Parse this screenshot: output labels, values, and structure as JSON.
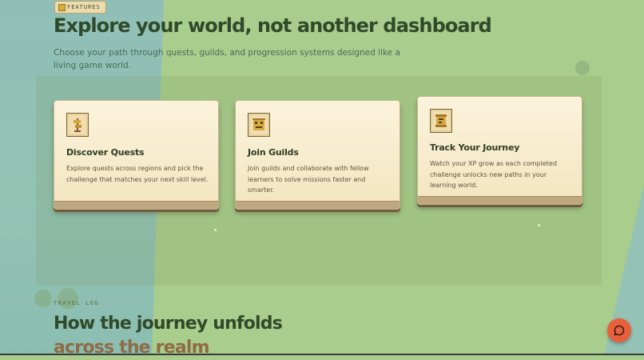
{
  "header": {
    "eyebrow": "FEATURES",
    "title": "Explore your world, not another dashboard",
    "subtitle": "Choose your path through quests, guilds, and progression systems designed like a living game world."
  },
  "features": [
    {
      "icon": "quest-signpost-icon",
      "title": "Discover Quests",
      "description": "Explore quests across regions and pick the challenge that matches your next skill level."
    },
    {
      "icon": "guild-face-icon",
      "title": "Join Guilds",
      "description": "Join guilds and collaborate with fellow learners to solve missions faster and smarter."
    },
    {
      "icon": "journey-scroll-icon",
      "title": "Track Your Journey",
      "description": "Watch your XP grow as each completed challenge unlocks new paths in your learning world."
    }
  ],
  "journey": {
    "eyebrow": "TRAVEL LOG",
    "title": "How the journey unfolds",
    "title_accent": "across the realm"
  },
  "chat": {
    "icon": "chat-bubble-icon"
  },
  "colors": {
    "accent": "#e8603b",
    "heading": "#2f4a2a",
    "card": "#f7ecd0"
  }
}
